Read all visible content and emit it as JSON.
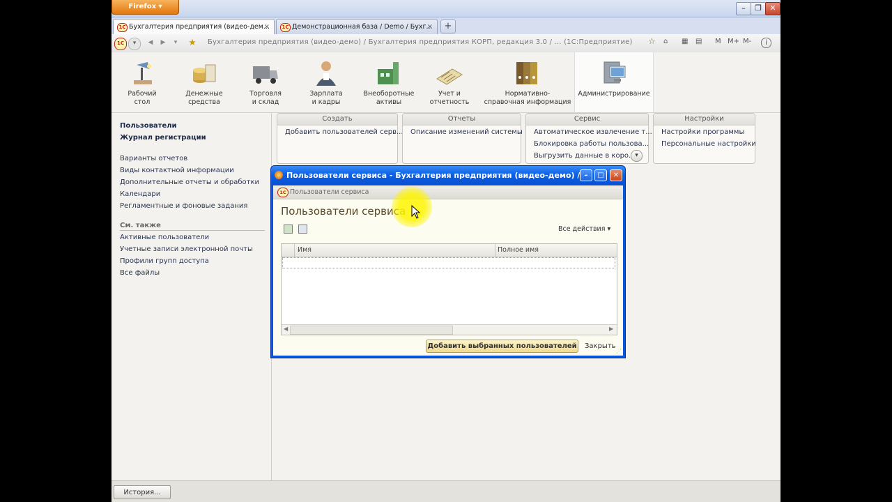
{
  "browser": {
    "menu_button": "Firefox",
    "tabs": [
      {
        "label": "Бухгалтерия предприятия (видео-дем...",
        "close": "×",
        "active": true
      },
      {
        "label": "Демонстрационная база / Demo / Бухг...",
        "close": "×",
        "active": false
      }
    ],
    "new_tab": "+",
    "nav_title": "Бухгалтерия предприятия  (видео-демо)  /  Бухгалтерия предприятия КОРП, редакция 3.0 / ...  (1С:Предприятие)",
    "nav_right": [
      "M",
      "M+",
      "M-"
    ]
  },
  "sections": [
    {
      "label1": "Рабочий",
      "label2": "стол",
      "icon": "desk-lamp-icon"
    },
    {
      "label1": "Денежные",
      "label2": "средства",
      "icon": "coins-icon"
    },
    {
      "label1": "Торговля",
      "label2": "и склад",
      "icon": "truck-icon"
    },
    {
      "label1": "Зарплата",
      "label2": "и кадры",
      "icon": "person-icon"
    },
    {
      "label1": "Внеоборотные",
      "label2": "активы",
      "icon": "factory-icon"
    },
    {
      "label1": "Учет и",
      "label2": "отчетность",
      "icon": "calculator-icon"
    },
    {
      "label1": "Нормативно-",
      "label2": "справочная информация",
      "icon": "binders-icon"
    },
    {
      "label1": "Администрирование",
      "label2": "",
      "icon": "server-icon",
      "active": true
    }
  ],
  "left_panel": {
    "primary": [
      "Пользователи",
      "Журнал регистрации"
    ],
    "items": [
      "Варианты отчетов",
      "Виды контактной информации",
      "Дополнительные отчеты и обработки",
      "Календари",
      "Регламентные и фоновые задания"
    ],
    "see_also_title": "См. также",
    "see_also": [
      "Активные пользователи",
      "Учетные записи электронной почты",
      "Профили групп доступа",
      "Все файлы"
    ]
  },
  "command_groups": [
    {
      "title": "Создать",
      "items": [
        "Добавить пользователей серв..."
      ]
    },
    {
      "title": "Отчеты",
      "items": [
        "Описание изменений системы"
      ]
    },
    {
      "title": "Сервис",
      "items": [
        "Автоматическое извлечение т...",
        "Блокировка работы пользова...",
        "Выгрузить данные в коро..."
      ]
    },
    {
      "title": "Настройки",
      "items": [
        "Настройки программы",
        "Персональные настройки"
      ]
    }
  ],
  "dialog": {
    "window_title": "Пользователи сервиса - Бухгалтерия предприятия (видео-демо) / ...",
    "subheader": "Пользователи сервиса",
    "form_title": "Пользователи сервиса",
    "all_actions": "Все действия",
    "columns": [
      "Имя",
      "Полное имя"
    ],
    "add_button": "Добавить выбранных пользователей",
    "close_link": "Закрыть"
  },
  "bottom": {
    "history_button": "История..."
  }
}
